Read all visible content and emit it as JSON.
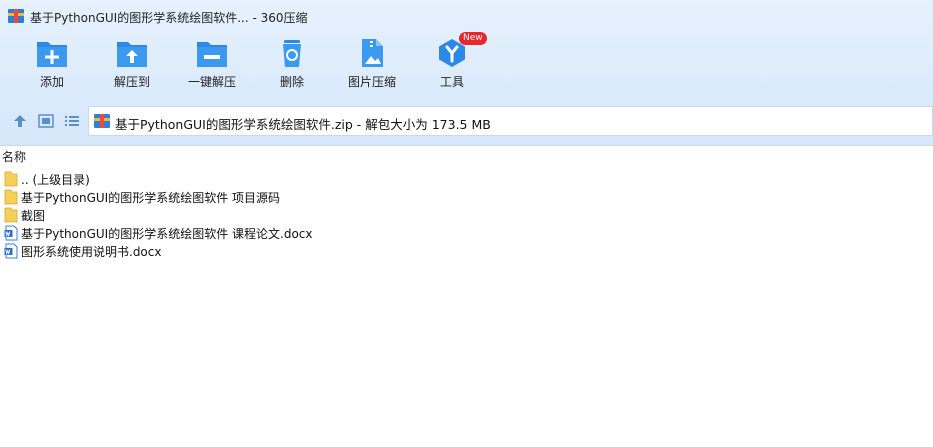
{
  "window": {
    "title": "基于PythonGUI的图形学系统绘图软件... - 360压缩"
  },
  "toolbar": {
    "items": [
      {
        "label": "添加",
        "icon": "add-icon"
      },
      {
        "label": "解压到",
        "icon": "extract-to-icon"
      },
      {
        "label": "一键解压",
        "icon": "one-click-extract-icon"
      },
      {
        "label": "删除",
        "icon": "delete-icon"
      },
      {
        "label": "图片压缩",
        "icon": "image-compress-icon"
      },
      {
        "label": "工具",
        "icon": "tools-icon",
        "badge": "New"
      }
    ]
  },
  "path": {
    "text": "基于PythonGUI的图形学系统绘图软件.zip - 解包大小为 173.5 MB"
  },
  "list": {
    "column_name": "名称",
    "items": [
      {
        "name": ".. (上级目录)",
        "type": "folder"
      },
      {
        "name": "基于PythonGUI的图形学系统绘图软件 项目源码",
        "type": "folder"
      },
      {
        "name": "截图",
        "type": "folder"
      },
      {
        "name": "基于PythonGUI的图形学系统绘图软件 课程论文.docx",
        "type": "docx"
      },
      {
        "name": "图形系统使用说明书.docx",
        "type": "docx"
      }
    ]
  },
  "colors": {
    "accent": "#2b8ae6",
    "badge": "#e8262b",
    "folder": "#f6cf5a"
  }
}
